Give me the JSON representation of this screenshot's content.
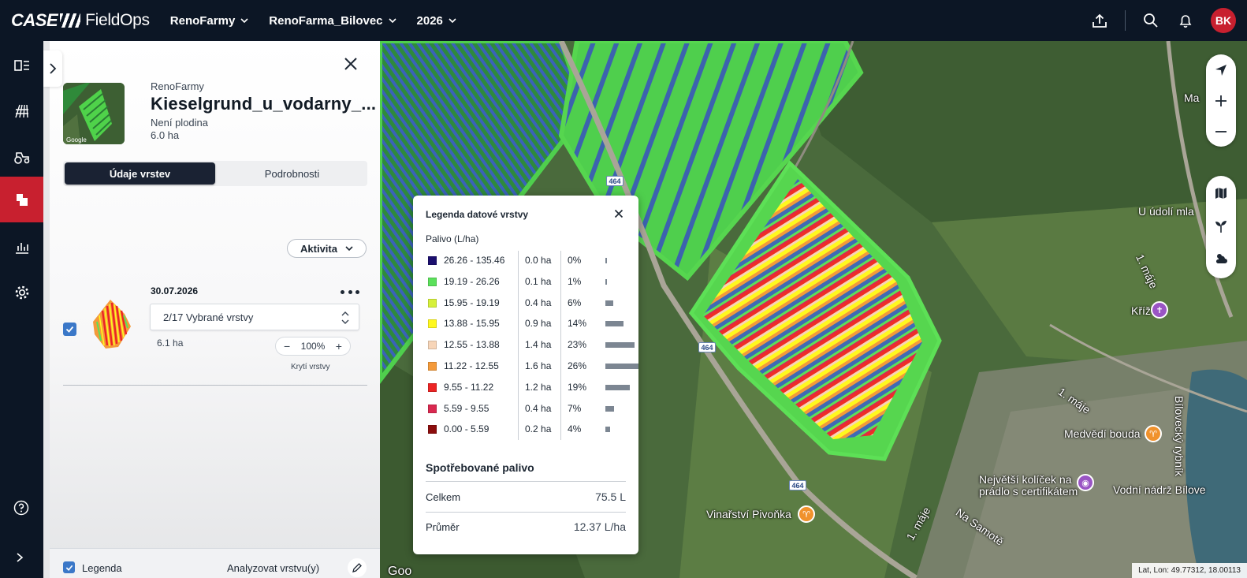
{
  "topbar": {
    "brand_case": "CASE",
    "brand_app": "FieldOps",
    "organization": "RenoFarmy",
    "farm": "RenoFarma_Bilovec",
    "year": "2026",
    "user_initials": "BK"
  },
  "rail": {
    "items": [
      "dashboard-icon",
      "field-icon",
      "machine-icon",
      "layers-icon",
      "reports-icon",
      "settings-icon"
    ],
    "active": "layers-icon"
  },
  "panel": {
    "farm_label": "RenoFarmy",
    "field_name": "Kieselgrund_u_vodarny_...",
    "crop": "Není plodina",
    "area": "6.0 ha",
    "thumb_credit": "Google",
    "tabs": [
      {
        "label": "Údaje vrstev",
        "active": true
      },
      {
        "label": "Podrobnosti",
        "active": false
      }
    ],
    "activity_label": "Aktivita",
    "layer": {
      "date": "30.07.2026",
      "checked": true,
      "selected_layers": "2/17 Vybrané vrstvy",
      "area": "6.1 ha",
      "opacity_minus": "−",
      "opacity_value": "100%",
      "opacity_plus": "+",
      "opacity_label": "Krytí vrstvy"
    },
    "bottom": {
      "legend_label": "Legenda",
      "legend_checked": true,
      "analyze_label": "Analyzovat vrstvu(y)"
    }
  },
  "legend": {
    "title": "Legenda datové vrstvy",
    "unit": "Palivo (L/ha)",
    "rows": [
      {
        "color": "#1b0f6e",
        "range": "26.26 - 135.46",
        "ha": "0.0 ha",
        "pct": "0%",
        "share": 0
      },
      {
        "color": "#5be05b",
        "range": "19.19 - 26.26",
        "ha": "0.1 ha",
        "pct": "1%",
        "share": 1
      },
      {
        "color": "#d6f03a",
        "range": "15.95 - 19.19",
        "ha": "0.4 ha",
        "pct": "6%",
        "share": 6
      },
      {
        "color": "#fff81e",
        "range": "13.88 - 15.95",
        "ha": "0.9 ha",
        "pct": "14%",
        "share": 14
      },
      {
        "color": "#f7d5b8",
        "range": "12.55 - 13.88",
        "ha": "1.4 ha",
        "pct": "23%",
        "share": 23
      },
      {
        "color": "#f49a3a",
        "range": "11.22 - 12.55",
        "ha": "1.6 ha",
        "pct": "26%",
        "share": 26
      },
      {
        "color": "#ec2424",
        "range": "9.55 - 11.22",
        "ha": "1.2 ha",
        "pct": "19%",
        "share": 19
      },
      {
        "color": "#d9284f",
        "range": "5.59 - 9.55",
        "ha": "0.4 ha",
        "pct": "7%",
        "share": 7
      },
      {
        "color": "#8b0d0d",
        "range": "0.00 - 5.59",
        "ha": "0.2 ha",
        "pct": "4%",
        "share": 4
      }
    ],
    "consumed_title": "Spotřebované palivo",
    "total_label": "Celkem",
    "total_value": "75.5 L",
    "avg_label": "Průměr",
    "avg_value": "12.37 L/ha"
  },
  "map": {
    "labels": {
      "u_udoli": "U údolí mla",
      "kriz": "Kříž",
      "medvedi": "Medvědí bouda",
      "nejvetsi_1": "Největší kolíček na",
      "nejvetsi_2": "prádlo s certifikátem",
      "vodni": "Vodní nádrž Bílove",
      "vinarstvi": "Vinařství Pivoňka",
      "ma": "Ma",
      "maje1": "1. máje",
      "maje2": "1. máje",
      "maje3": "1. máje",
      "samote": "Na Samotě",
      "rybnik": "Bílovecký rybník",
      "google": "Goo"
    },
    "road_number": "464",
    "coords": "Lat, Lon: 49.77312, 18.00113"
  }
}
